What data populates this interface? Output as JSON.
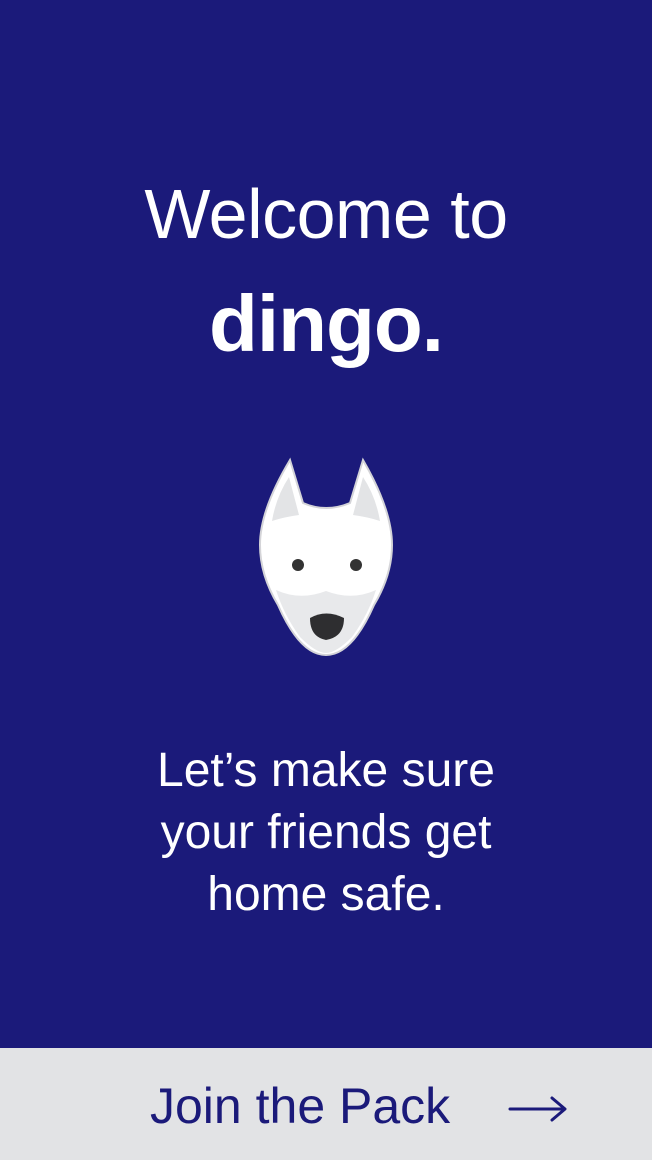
{
  "welcome": {
    "line1": "Welcome to",
    "line2": "dingo."
  },
  "mascot": {
    "icon": "dog-face-icon"
  },
  "tagline": {
    "lines": [
      "Let’s make sure",
      "your friends get",
      "home safe."
    ]
  },
  "cta": {
    "label": "Join the Pack",
    "icon": "arrow-right-icon"
  },
  "colors": {
    "background": "#1b1a7a",
    "cta_background": "#e2e3e5",
    "cta_text": "#1b1a7a",
    "text": "#ffffff"
  }
}
